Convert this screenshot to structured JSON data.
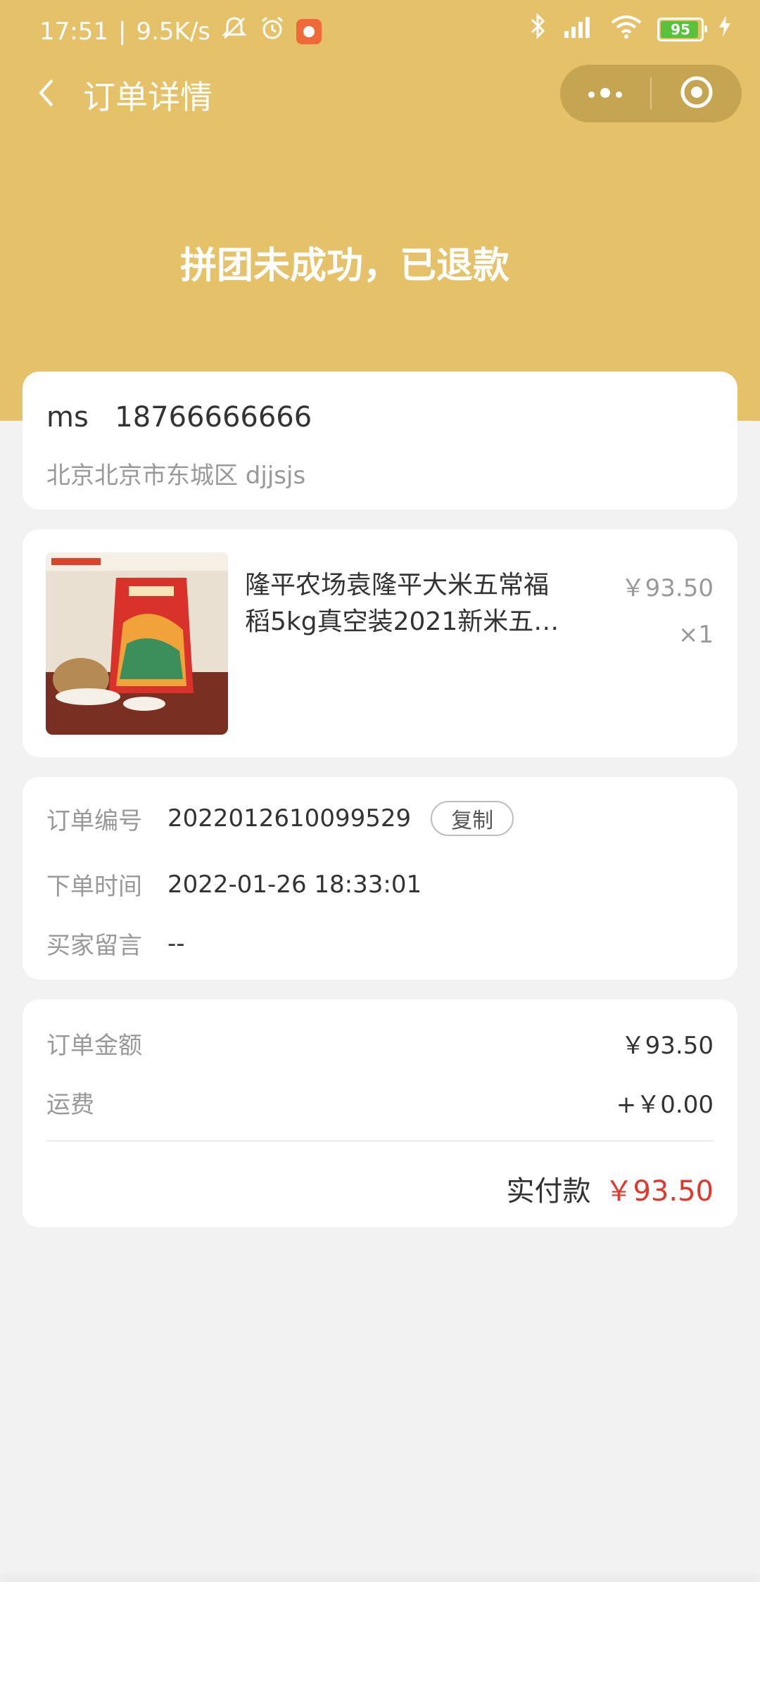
{
  "status_bar": {
    "time": "17:51",
    "separator": "|",
    "speed": "9.5K/s",
    "battery": "95",
    "colors": {
      "text": "#ffffff",
      "battery_fill": "#58c23a"
    },
    "battery_level_percent": 95,
    "icons": [
      "mute-icon",
      "alarm-icon",
      "app-notification-icon",
      "bluetooth-icon",
      "signal-icon",
      "wifi-icon",
      "battery-icon",
      "charging-icon"
    ]
  },
  "nav": {
    "title": "订单详情",
    "icons": [
      "back-icon",
      "more-icon",
      "target-icon"
    ]
  },
  "hero": {
    "status_text": "拼团未成功，已退款"
  },
  "address": {
    "name": "ms",
    "phone": "18766666666",
    "detail": "北京北京市东城区 djjsjs"
  },
  "product": {
    "title": "隆平农场袁隆平大米五常福稻5kg真空装2021新米五…",
    "price": "￥93.50",
    "quantity": "×1"
  },
  "order_info": {
    "rows": [
      {
        "label": "订单编号",
        "value": "2022012610099529"
      },
      {
        "label": "下单时间",
        "value": "2022-01-26 18:33:01"
      },
      {
        "label": "买家留言",
        "value": "--"
      }
    ],
    "copy_label": "复制"
  },
  "amounts": {
    "order_amount_label": "订单金额",
    "order_amount": "￥93.50",
    "shipping_label": "运费",
    "shipping": "+￥0.00",
    "paid_label": "实付款",
    "paid": "￥93.50"
  },
  "colors": {
    "header": "#e5c26a",
    "background": "#f2f2f2",
    "price_red": "#e0382d",
    "muted_text": "#999999"
  }
}
